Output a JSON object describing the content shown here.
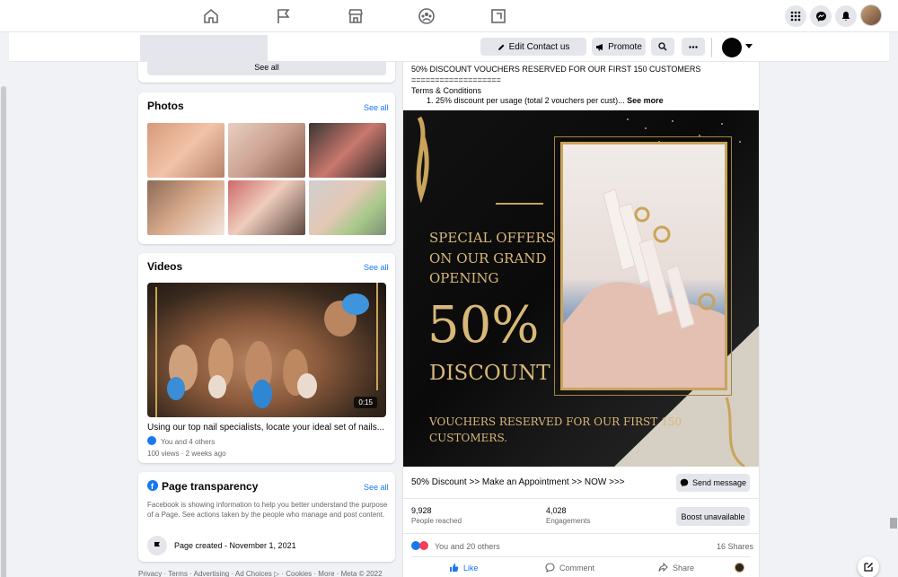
{
  "pagebar": {
    "edit_contact": "Edit Contact us",
    "promote": "Promote"
  },
  "left": {
    "see_all_button": "See all",
    "photos": {
      "title": "Photos",
      "see_all": "See all"
    },
    "videos": {
      "title": "Videos",
      "see_all": "See all",
      "duration": "0:15",
      "caption": "Using our top nail specialists, locate your ideal set of nails...",
      "reactions": "You and 4 others",
      "meta": "100 views · 2 weeks ago"
    },
    "transparency": {
      "title": "Page transparency",
      "see_all": "See all",
      "description": "Facebook is showing information to help you better understand the purpose of a Page. See actions taken by the people who manage and post content.",
      "created": "Page created - November 1, 2021"
    },
    "footer": "Privacy · Terms · Advertising · Ad Choices ▷ · Cookies · More · Meta © 2022"
  },
  "post": {
    "line1": "50% DISCOUNT VOUCHERS RESERVED FOR OUR FIRST 150 CUSTOMERS",
    "line2": "===================",
    "line3": "Terms & Conditions",
    "line4": "1. 25% discount per usage (total 2 vouchers per cust)...",
    "see_more": "See more",
    "ad": {
      "headline1": "SPECIAL OFFERS",
      "headline2": "ON OUR GRAND",
      "headline3": "OPENING",
      "percent": "50%",
      "discount": "DISCOUNT",
      "sub1": "VOUCHERS RESERVED FOR OUR FIRST 150",
      "sub2": "CUSTOMERS."
    },
    "cta_text": "50% Discount >> Make an Appointment >> NOW >>>",
    "send_message": "Send message",
    "people_reached_num": "9,928",
    "people_reached_lbl": "People reached",
    "engagements_num": "4,028",
    "engagements_lbl": "Engagements",
    "boost": "Boost unavailable",
    "reactions": "You and 20 others",
    "shares": "16 Shares",
    "like": "Like",
    "comment": "Comment",
    "share": "Share"
  },
  "colors": {
    "accent": "#1877f2",
    "gold": "#d8b878"
  }
}
